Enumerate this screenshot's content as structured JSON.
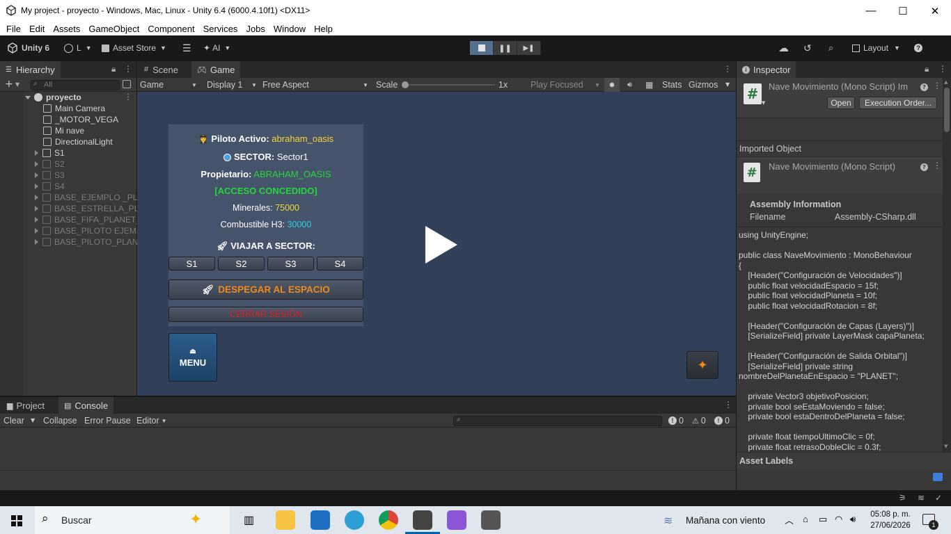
{
  "window": {
    "title": "My project - proyecto - Windows, Mac, Linux - Unity 6.4 (6000.4.10f1) <DX11>",
    "minimize": "—",
    "maximize": "☐",
    "close": "✕"
  },
  "menu": [
    "File",
    "Edit",
    "Assets",
    "GameObject",
    "Component",
    "Services",
    "Jobs",
    "Window",
    "Help"
  ],
  "toolbar": {
    "unity_label": "Unity 6",
    "account_label": "L",
    "asset_store_label": "Asset Store",
    "ai_label": "AI",
    "layout_label": "Layout"
  },
  "hierarchy": {
    "tab_label": "Hierarchy",
    "search_placeholder": "All",
    "root": "proyecto",
    "items": [
      {
        "label": "Main Camera",
        "dim": false,
        "expandable": false
      },
      {
        "label": "_MOTOR_VEGA",
        "dim": false,
        "expandable": false
      },
      {
        "label": "Mi nave",
        "dim": false,
        "expandable": false
      },
      {
        "label": "DirectionalLight",
        "dim": false,
        "expandable": false
      },
      {
        "label": "S1",
        "dim": false,
        "expandable": true
      },
      {
        "label": "S2",
        "dim": true,
        "expandable": true
      },
      {
        "label": "S3",
        "dim": true,
        "expandable": true
      },
      {
        "label": "S4",
        "dim": true,
        "expandable": true
      },
      {
        "label": "BASE_EJEMPLO _PLA",
        "dim": true,
        "expandable": true
      },
      {
        "label": "BASE_ESTRELLA_PLA",
        "dim": true,
        "expandable": true
      },
      {
        "label": "BASE_FIFA_PLANET_",
        "dim": true,
        "expandable": true
      },
      {
        "label": "BASE_PILOTO EJEMP",
        "dim": true,
        "expandable": true
      },
      {
        "label": "BASE_PILOTO_PLAN",
        "dim": true,
        "expandable": true
      }
    ]
  },
  "center_tabs": {
    "scene": "Scene",
    "game": "Game"
  },
  "game_toolbar": {
    "display_mode": "Game",
    "display": "Display 1",
    "aspect": "Free Aspect",
    "scale_label": "Scale",
    "scale_value": "1x",
    "play_mode": "Play Focused",
    "stats": "Stats",
    "gizmos": "Gizmos"
  },
  "game_ui": {
    "pilot_label": "Piloto Activo:",
    "pilot_value": "abraham_oasis",
    "pilot_emoji": "🧑‍✈️",
    "sector_label": "SECTOR:",
    "sector_value": "Sector1",
    "owner_label": "Propietario:",
    "owner_value": "ABRAHAM_OASIS",
    "access": "[ACCESO CONCEDIDO]",
    "minerals_label": "Minerales:",
    "minerals_value": "75000",
    "fuel_label": "Combustible H3:",
    "fuel_value": "30000",
    "travel_label": "VIAJAR A SECTOR:",
    "sectors": [
      "S1",
      "S2",
      "S3",
      "S4"
    ],
    "launch_button": "DESPEGAR AL ESPACIO",
    "logout_button": "CERRAR SESIÓN",
    "menu_button": "MENU",
    "colors": {
      "yellow": "#f5d63a",
      "green": "#27d63c",
      "cyan": "#2ed0e8",
      "orange": "#f08a1a",
      "red": "#e02020"
    }
  },
  "bottom": {
    "project_tab": "Project",
    "console_tab": "Console",
    "clear": "Clear",
    "collapse": "Collapse",
    "error_pause": "Error Pause",
    "editor": "Editor",
    "count_errors": "0",
    "count_warnings": "0",
    "count_logs": "0"
  },
  "inspector": {
    "tab_label": "Inspector",
    "header_title": "Nave Movimiento (Mono Script) Im",
    "open_button": "Open",
    "execution_order_button": "Execution Order...",
    "imported_object": "Imported Object",
    "script_title": "Nave Movimiento (Mono Script)",
    "assembly_info": "Assembly Information",
    "filename_label": "Filename",
    "filename_value": "Assembly-CSharp.dll",
    "code": "using UnityEngine;\n\npublic class NaveMovimiento : MonoBehaviour\n{\n    [Header(\"Configuración de Velocidades\")]\n    public float velocidadEspacio = 15f;\n    public float velocidadPlaneta = 10f;\n    public float velocidadRotacion = 8f;\n\n    [Header(\"Configuración de Capas (Layers)\")]\n    [SerializeField] private LayerMask capaPlaneta;\n\n    [Header(\"Configuración de Salida Orbital\")]\n    [SerializeField] private string\nnombreDelPlanetaEnEspacio = \"PLANET\";\n\n    private Vector3 objetivoPosicion;\n    private bool seEstaMoviendo = false;\n    private bool estaDentroDelPlaneta = false;\n\n    private float tiempoUltimoClic = 0f;\n    private float retrasoDobleClic = 0.3f;",
    "asset_labels": "Asset Labels"
  },
  "taskbar": {
    "search_label": "Buscar",
    "weather": "Mañana con viento",
    "time": "05:08 p. m.",
    "date": "27/06/2026",
    "notification_count": "1"
  }
}
